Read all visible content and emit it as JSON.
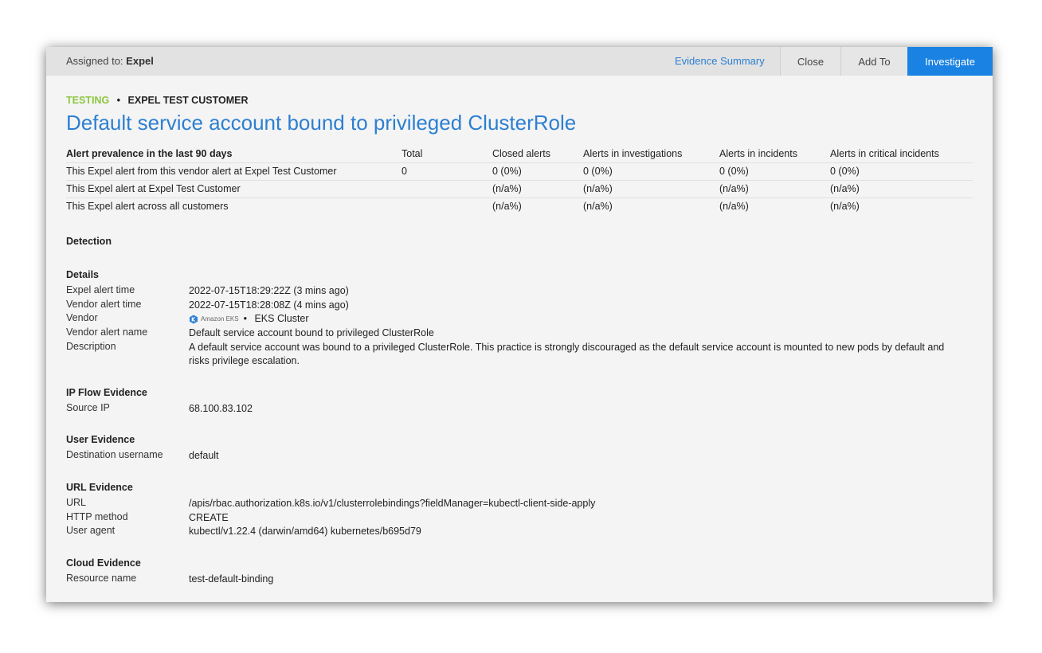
{
  "topbar": {
    "assigned_label": "Assigned to:",
    "assigned_value": "Expel",
    "evidence_summary": "Evidence Summary",
    "close": "Close",
    "add_to": "Add To",
    "investigate": "Investigate"
  },
  "header": {
    "status": "TESTING",
    "customer": "EXPEL TEST CUSTOMER",
    "title": "Default service account bound to privileged ClusterRole"
  },
  "prevalence": {
    "columns": [
      "Alert prevalence in the last 90 days",
      "Total",
      "Closed alerts",
      "Alerts in investigations",
      "Alerts in incidents",
      "Alerts in critical incidents"
    ],
    "rows": [
      [
        "This Expel alert from this vendor alert at Expel Test Customer",
        "0",
        "0 (0%)",
        "0 (0%)",
        "0 (0%)",
        "0 (0%)"
      ],
      [
        "This Expel alert at Expel Test Customer",
        "",
        "(n/a%)",
        "(n/a%)",
        "(n/a%)",
        "(n/a%)"
      ],
      [
        "This Expel alert across all customers",
        "",
        "(n/a%)",
        "(n/a%)",
        "(n/a%)",
        "(n/a%)"
      ]
    ]
  },
  "detection": {
    "heading": "Detection",
    "details_heading": "Details",
    "expel_alert_time_label": "Expel alert time",
    "expel_alert_time": "2022-07-15T18:29:22Z (3 mins ago)",
    "vendor_alert_time_label": "Vendor alert time",
    "vendor_alert_time": "2022-07-15T18:28:08Z (4 mins ago)",
    "vendor_label": "Vendor",
    "vendor_logo_text": "Amazon EKS",
    "vendor_value": "EKS Cluster",
    "vendor_alert_name_label": "Vendor alert name",
    "vendor_alert_name": "Default service account bound to privileged ClusterRole",
    "description_label": "Description",
    "description": "A default service account was bound to a privileged ClusterRole. This practice is strongly discouraged as the default service account is mounted to new pods by default and risks privilege escalation."
  },
  "ip_flow": {
    "heading": "IP Flow Evidence",
    "source_ip_label": "Source IP",
    "source_ip": "68.100.83.102"
  },
  "user_evidence": {
    "heading": "User Evidence",
    "dest_username_label": "Destination username",
    "dest_username": "default"
  },
  "url_evidence": {
    "heading": "URL Evidence",
    "url_label": "URL",
    "url": "/apis/rbac.authorization.k8s.io/v1/clusterrolebindings?fieldManager=kubectl-client-side-apply",
    "http_method_label": "HTTP method",
    "http_method": "CREATE",
    "user_agent_label": "User agent",
    "user_agent": "kubectl/v1.22.4 (darwin/amd64) kubernetes/b695d79"
  },
  "cloud_evidence": {
    "heading": "Cloud Evidence",
    "resource_name_label": "Resource name",
    "resource_name": "test-default-binding"
  },
  "colors": {
    "accent": "#1a82e2",
    "title": "#2d7fd1",
    "testing": "#8cc63f"
  }
}
